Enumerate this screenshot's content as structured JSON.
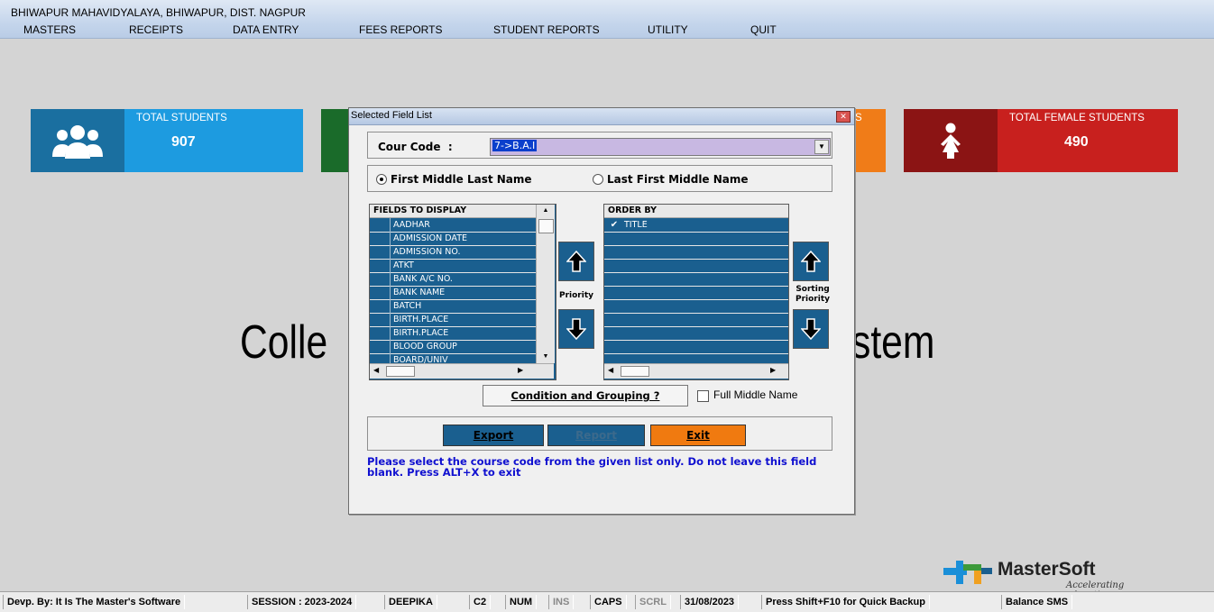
{
  "app": {
    "title": "BHIWAPUR MAHAVIDYALAYA, BHIWAPUR, DIST. NAGPUR",
    "menu": [
      "MASTERS",
      "RECEIPTS",
      "DATA ENTRY",
      "FEES REPORTS",
      "STUDENT REPORTS",
      "UTILITY",
      "QUIT"
    ]
  },
  "dashboard": {
    "total_students": {
      "label": "TOTAL STUDENTS",
      "value": "907",
      "icon": "group-icon"
    },
    "partial_tile_label": "S",
    "total_female": {
      "label": "TOTAL FEMALE STUDENTS",
      "value": "490",
      "icon": "female-icon"
    },
    "background_text_left": "Colle",
    "background_text_right": "stem"
  },
  "dialog": {
    "title": "Selected Field List",
    "course_code_label": "Cour Code  :",
    "course_code_value": "7->B.A.I",
    "name_order_options": [
      "First Middle Last Name",
      "Last First Middle Name"
    ],
    "name_order_selected": 0,
    "fields_header": "FIELDS TO DISPLAY",
    "fields": [
      "AADHAR",
      "ADMISSION DATE",
      "ADMISSION NO.",
      "ATKT",
      "BANK A/C NO.",
      "BANK NAME",
      "BATCH",
      "BIRTH.PLACE",
      "BIRTH.PLACE",
      "BLOOD GROUP",
      "BOARD/UNIV"
    ],
    "orderby_header": "ORDER BY",
    "orderby_items": [
      "TITLE"
    ],
    "priority_label": "Priority",
    "sorting_priority_label": "Sorting Priority",
    "condition_button": "Condition and Grouping ?",
    "full_middle_name_label": "Full Middle Name",
    "export_button": "Export",
    "report_button": "Report",
    "exit_button": "Exit",
    "help_text": "Please select the course code from the given list only. Do not leave this field blank. Press ALT+X to exit"
  },
  "brand": {
    "name": "MasterSoft",
    "tagline": "Accelerating education...."
  },
  "statusbar": [
    "Devp. By: It Is The Master's Software",
    "SESSION : 2023-2024",
    "DEEPIKA",
    "C2",
    "NUM",
    "INS",
    "CAPS",
    "SCRL",
    "31/08/2023",
    "Press Shift+F10 for Quick Backup",
    "Balance SMS"
  ],
  "colors": {
    "tile_blue": "#1d9be0",
    "tile_blue_dark": "#1a6fa0",
    "tile_green": "#1a6b2a",
    "tile_orange": "#f07c18",
    "tile_red": "#c8201e",
    "tile_red_dark": "#8b1414",
    "list_bg": "#1a5f8f",
    "export_btn": "#1a5f8f",
    "exit_btn": "#f07a10",
    "help_text": "#1010d0"
  }
}
